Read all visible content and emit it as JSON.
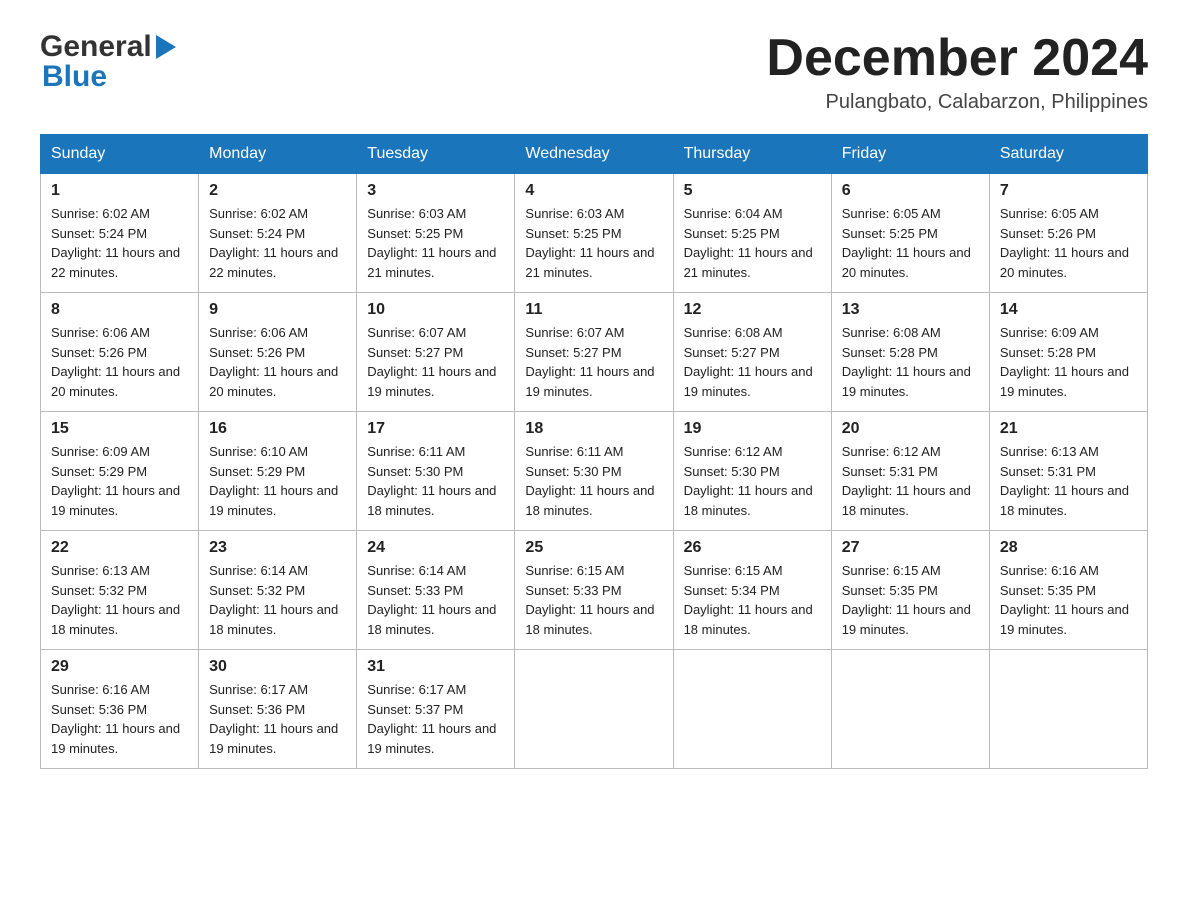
{
  "header": {
    "logo_general": "General",
    "logo_blue": "Blue",
    "main_title": "December 2024",
    "subtitle": "Pulangbato, Calabarzon, Philippines"
  },
  "calendar": {
    "days_of_week": [
      "Sunday",
      "Monday",
      "Tuesday",
      "Wednesday",
      "Thursday",
      "Friday",
      "Saturday"
    ],
    "weeks": [
      [
        {
          "num": "1",
          "sunrise": "6:02 AM",
          "sunset": "5:24 PM",
          "daylight": "11 hours and 22 minutes."
        },
        {
          "num": "2",
          "sunrise": "6:02 AM",
          "sunset": "5:24 PM",
          "daylight": "11 hours and 22 minutes."
        },
        {
          "num": "3",
          "sunrise": "6:03 AM",
          "sunset": "5:25 PM",
          "daylight": "11 hours and 21 minutes."
        },
        {
          "num": "4",
          "sunrise": "6:03 AM",
          "sunset": "5:25 PM",
          "daylight": "11 hours and 21 minutes."
        },
        {
          "num": "5",
          "sunrise": "6:04 AM",
          "sunset": "5:25 PM",
          "daylight": "11 hours and 21 minutes."
        },
        {
          "num": "6",
          "sunrise": "6:05 AM",
          "sunset": "5:25 PM",
          "daylight": "11 hours and 20 minutes."
        },
        {
          "num": "7",
          "sunrise": "6:05 AM",
          "sunset": "5:26 PM",
          "daylight": "11 hours and 20 minutes."
        }
      ],
      [
        {
          "num": "8",
          "sunrise": "6:06 AM",
          "sunset": "5:26 PM",
          "daylight": "11 hours and 20 minutes."
        },
        {
          "num": "9",
          "sunrise": "6:06 AM",
          "sunset": "5:26 PM",
          "daylight": "11 hours and 20 minutes."
        },
        {
          "num": "10",
          "sunrise": "6:07 AM",
          "sunset": "5:27 PM",
          "daylight": "11 hours and 19 minutes."
        },
        {
          "num": "11",
          "sunrise": "6:07 AM",
          "sunset": "5:27 PM",
          "daylight": "11 hours and 19 minutes."
        },
        {
          "num": "12",
          "sunrise": "6:08 AM",
          "sunset": "5:27 PM",
          "daylight": "11 hours and 19 minutes."
        },
        {
          "num": "13",
          "sunrise": "6:08 AM",
          "sunset": "5:28 PM",
          "daylight": "11 hours and 19 minutes."
        },
        {
          "num": "14",
          "sunrise": "6:09 AM",
          "sunset": "5:28 PM",
          "daylight": "11 hours and 19 minutes."
        }
      ],
      [
        {
          "num": "15",
          "sunrise": "6:09 AM",
          "sunset": "5:29 PM",
          "daylight": "11 hours and 19 minutes."
        },
        {
          "num": "16",
          "sunrise": "6:10 AM",
          "sunset": "5:29 PM",
          "daylight": "11 hours and 19 minutes."
        },
        {
          "num": "17",
          "sunrise": "6:11 AM",
          "sunset": "5:30 PM",
          "daylight": "11 hours and 18 minutes."
        },
        {
          "num": "18",
          "sunrise": "6:11 AM",
          "sunset": "5:30 PM",
          "daylight": "11 hours and 18 minutes."
        },
        {
          "num": "19",
          "sunrise": "6:12 AM",
          "sunset": "5:30 PM",
          "daylight": "11 hours and 18 minutes."
        },
        {
          "num": "20",
          "sunrise": "6:12 AM",
          "sunset": "5:31 PM",
          "daylight": "11 hours and 18 minutes."
        },
        {
          "num": "21",
          "sunrise": "6:13 AM",
          "sunset": "5:31 PM",
          "daylight": "11 hours and 18 minutes."
        }
      ],
      [
        {
          "num": "22",
          "sunrise": "6:13 AM",
          "sunset": "5:32 PM",
          "daylight": "11 hours and 18 minutes."
        },
        {
          "num": "23",
          "sunrise": "6:14 AM",
          "sunset": "5:32 PM",
          "daylight": "11 hours and 18 minutes."
        },
        {
          "num": "24",
          "sunrise": "6:14 AM",
          "sunset": "5:33 PM",
          "daylight": "11 hours and 18 minutes."
        },
        {
          "num": "25",
          "sunrise": "6:15 AM",
          "sunset": "5:33 PM",
          "daylight": "11 hours and 18 minutes."
        },
        {
          "num": "26",
          "sunrise": "6:15 AM",
          "sunset": "5:34 PM",
          "daylight": "11 hours and 18 minutes."
        },
        {
          "num": "27",
          "sunrise": "6:15 AM",
          "sunset": "5:35 PM",
          "daylight": "11 hours and 19 minutes."
        },
        {
          "num": "28",
          "sunrise": "6:16 AM",
          "sunset": "5:35 PM",
          "daylight": "11 hours and 19 minutes."
        }
      ],
      [
        {
          "num": "29",
          "sunrise": "6:16 AM",
          "sunset": "5:36 PM",
          "daylight": "11 hours and 19 minutes."
        },
        {
          "num": "30",
          "sunrise": "6:17 AM",
          "sunset": "5:36 PM",
          "daylight": "11 hours and 19 minutes."
        },
        {
          "num": "31",
          "sunrise": "6:17 AM",
          "sunset": "5:37 PM",
          "daylight": "11 hours and 19 minutes."
        },
        null,
        null,
        null,
        null
      ]
    ]
  }
}
